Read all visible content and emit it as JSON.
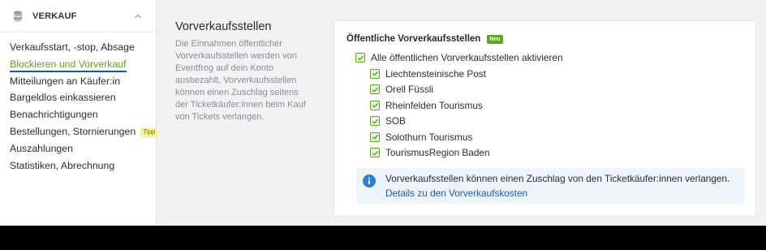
{
  "sidebar": {
    "section_title": "VERKAUF",
    "items": [
      {
        "label": "Verkaufsstart, -stop, Absage"
      },
      {
        "label": "Blockieren und Vorverkauf"
      },
      {
        "label": "Mitteilungen an Käufer:in"
      },
      {
        "label": "Bargeldlos einkassieren"
      },
      {
        "label": "Benachrichtigungen"
      },
      {
        "label": "Bestellungen, Stornierungen",
        "badge": "Tipp"
      },
      {
        "label": "Auszahlungen"
      },
      {
        "label": "Statistiken, Abrechnung"
      }
    ]
  },
  "description": {
    "title": "Vorverkaufsstellen",
    "text": "Die Einnahmen öffentlicher Vorverkaufsstellen werden von Eventfrog auf dein Konto ausbezahlt. Vorverkaufsstellen können einen Zuschlag seitens der Ticketkäufer:innen beim Kauf von Tickets verlangen."
  },
  "card": {
    "title": "Öffentliche Vorverkaufsstellen",
    "badge": "Neu",
    "master_option": "Alle öffentlichen Vorverkaufsstellen aktivieren",
    "options": [
      "Liechtensteinische Post",
      "Orell Füssli",
      "Rheinfelden Tourismus",
      "SOB",
      "Solothurn Tourismus",
      "TourismusRegion Baden"
    ],
    "info_text": "Vorverkaufsstellen können einen Zuschlag von den Ticketkäufer:innen verlangen.",
    "info_link": "Details zu den Vorverkaufskosten"
  },
  "colors": {
    "accent_green": "#5aa81e",
    "link_blue": "#1f5bbd",
    "info_bg": "#eef4fc"
  },
  "icons": {
    "section": "database-icon",
    "collapse": "chevron-up-icon",
    "check": "check-icon",
    "info": "info-icon"
  }
}
